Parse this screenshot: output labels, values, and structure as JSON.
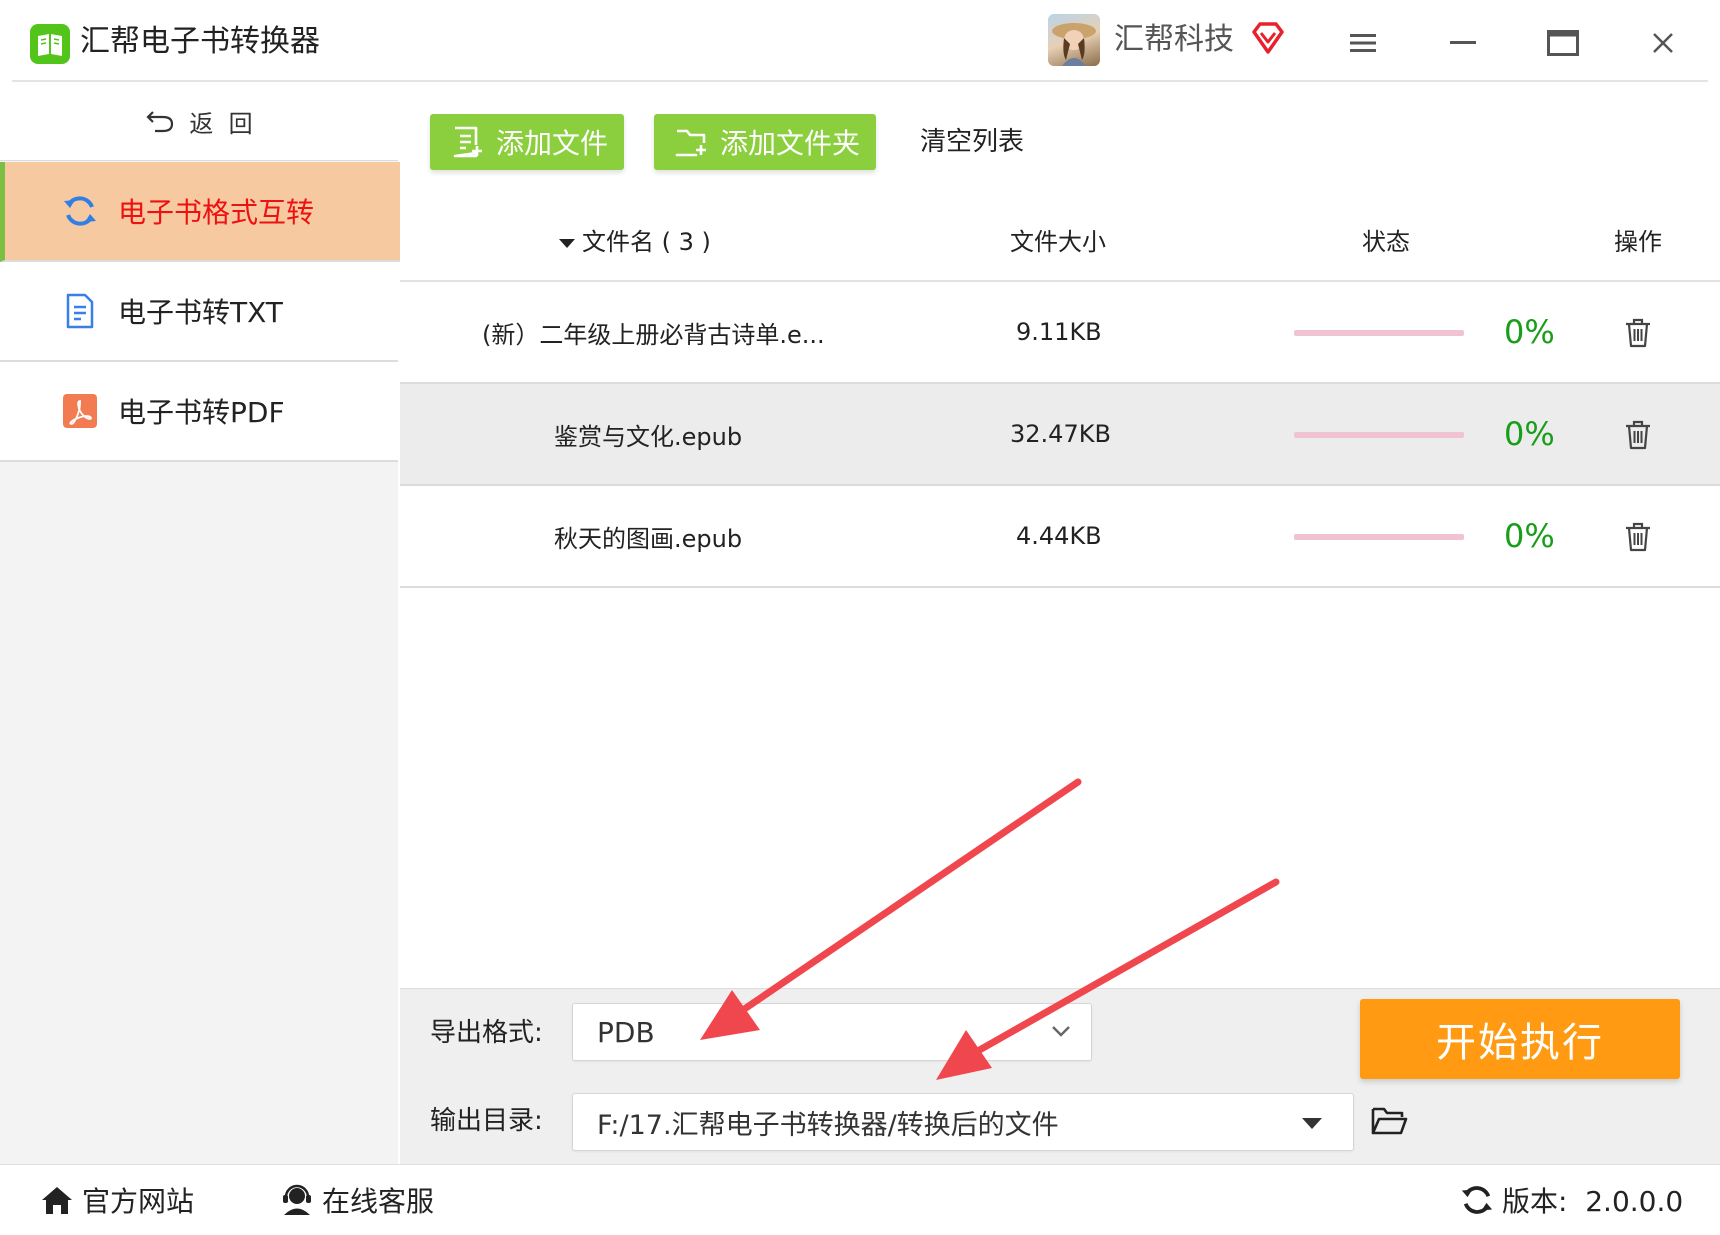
{
  "app": {
    "title": "汇帮电子书转换器",
    "company": "汇帮科技"
  },
  "sidebar": {
    "back_label": "返  回",
    "items": [
      {
        "label": "电子书格式互转",
        "active": true,
        "icon": "refresh-icon"
      },
      {
        "label": "电子书转TXT",
        "active": false,
        "icon": "txt-document-icon"
      },
      {
        "label": "电子书转PDF",
        "active": false,
        "icon": "pdf-icon"
      }
    ]
  },
  "toolbar": {
    "add_file": "添加文件",
    "add_folder": "添加文件夹",
    "clear_list": "清空列表"
  },
  "table": {
    "headers": {
      "name": "文件名 ( 3 )",
      "size": "文件大小",
      "status": "状态",
      "action": "操作"
    },
    "rows": [
      {
        "name": "(新）二年级上册必背古诗单.e...",
        "size": "9.11KB",
        "progress": 0,
        "percent": "0%"
      },
      {
        "name": "鉴赏与文化.epub",
        "size": "32.47KB",
        "progress": 0,
        "percent": "0%"
      },
      {
        "name": "秋天的图画.epub",
        "size": "4.44KB",
        "progress": 0,
        "percent": "0%"
      }
    ]
  },
  "settings": {
    "format_label": "导出格式:",
    "format_value": "PDB",
    "output_label": "输出目录:",
    "output_value": "F:/17.汇帮电子书转换器/转换后的文件",
    "start_button": "开始执行"
  },
  "footer": {
    "website": "官方网站",
    "support": "在线客服",
    "version": "版本:  2.0.0.0"
  },
  "colors": {
    "accent_green": "#8ccf3e",
    "active_bg": "#f7c9a0",
    "active_text": "#ee1111",
    "start_orange": "#ff9a12",
    "progress_track": "#f1c3d1",
    "percent_green": "#1a9e1a",
    "annotation_arrow": "#f0474f"
  }
}
